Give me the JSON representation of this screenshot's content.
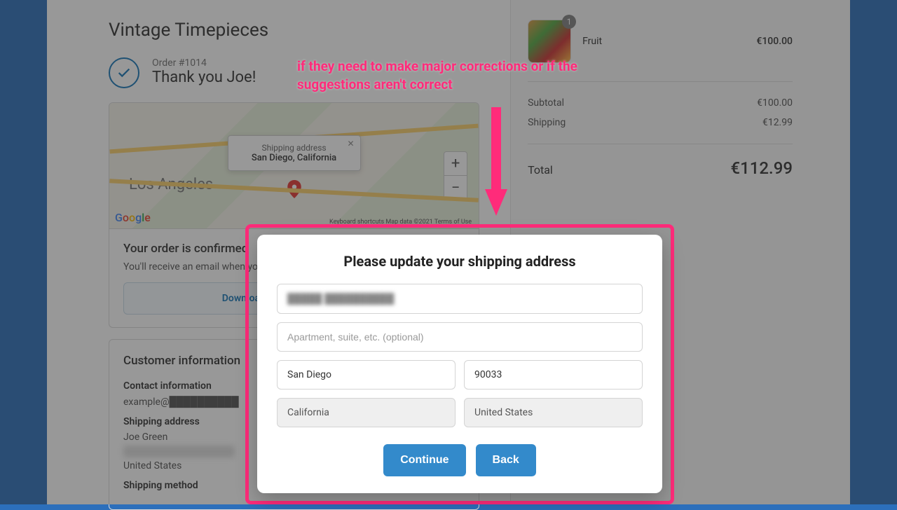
{
  "store_name": "Vintage Timepieces",
  "order_number": "Order #1014",
  "thank_you": "Thank you Joe!",
  "map": {
    "popup_label": "Shipping address",
    "popup_value": "San Diego, California",
    "city_label": "Los Angeles",
    "footer": "Keyboard shortcuts   Map data ©2021   Terms of Use"
  },
  "confirm": {
    "title": "Your order is confirmed",
    "body": "You'll receive an email when your order is ready.",
    "download": "Download Shop to track package"
  },
  "customer": {
    "heading": "Customer information",
    "contact_label": "Contact information",
    "contact_value": "example@██████████",
    "ship_label": "Shipping address",
    "ship_name": "Joe Green",
    "ship_lines_hidden": "████████████████",
    "ship_country": "United States",
    "method_label": "Shipping method"
  },
  "cart": {
    "item_name": "Fruit",
    "item_qty": "1",
    "item_price": "€100.00",
    "subtotal_label": "Subtotal",
    "subtotal_value": "€100.00",
    "shipping_label": "Shipping",
    "shipping_value": "€12.99",
    "total_label": "Total",
    "total_value": "€112.99"
  },
  "annotation": "if they need to make major corrections or if the suggestions aren't correct",
  "modal": {
    "title": "Please update your shipping address",
    "address1_value": "█████ ██████████",
    "address2_placeholder": "Apartment, suite, etc. (optional)",
    "city": "San Diego",
    "zip": "90033",
    "state": "California",
    "country": "United States",
    "continue": "Continue",
    "back": "Back"
  }
}
